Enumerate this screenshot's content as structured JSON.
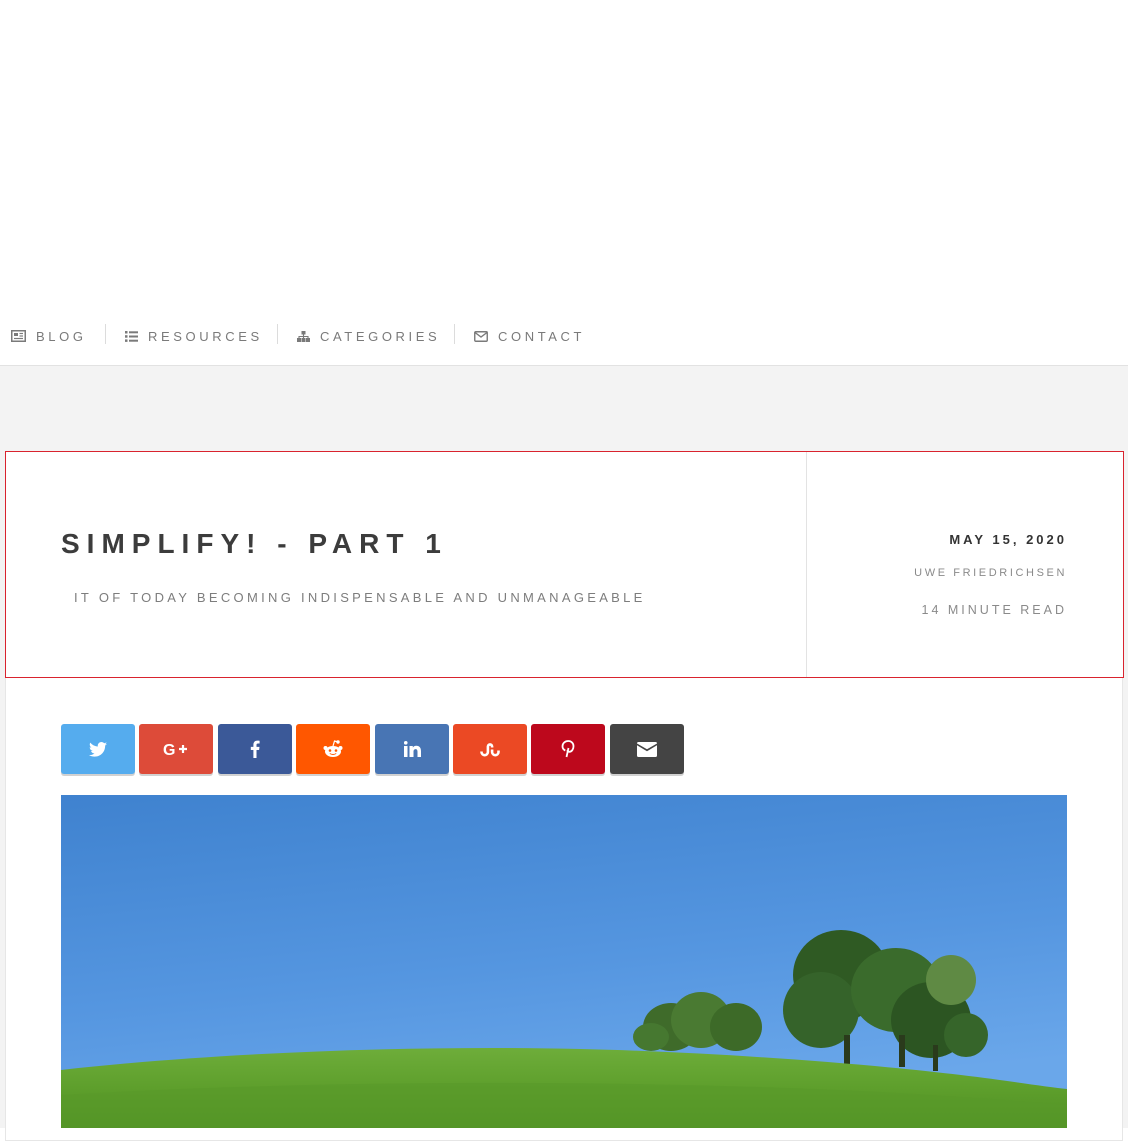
{
  "nav": {
    "items": [
      {
        "label": "BLOG",
        "icon": "newspaper-icon"
      },
      {
        "label": "RESOURCES",
        "icon": "list-icon"
      },
      {
        "label": "CATEGORIES",
        "icon": "sitemap-icon"
      },
      {
        "label": "CONTACT",
        "icon": "envelope-icon"
      }
    ]
  },
  "post": {
    "title": "SIMPLIFY! - PART 1",
    "subtitle": "IT OF TODAY BECOMING INDISPENSABLE AND UNMANAGEABLE",
    "date": "MAY 15, 2020",
    "author": "UWE FRIEDRICHSEN",
    "read_time": "14 MINUTE READ"
  },
  "share": {
    "buttons": [
      {
        "network": "twitter",
        "icon": "twitter-icon",
        "color": "#55acee"
      },
      {
        "network": "google-plus",
        "icon": "google-plus-icon",
        "color": "#dd4b39"
      },
      {
        "network": "facebook",
        "icon": "facebook-icon",
        "color": "#3b5998"
      },
      {
        "network": "reddit",
        "icon": "reddit-icon",
        "color": "#ff5700"
      },
      {
        "network": "linkedin",
        "icon": "linkedin-icon",
        "color": "#4875b4"
      },
      {
        "network": "stumbleupon",
        "icon": "stumbleupon-icon",
        "color": "#eb4924"
      },
      {
        "network": "pinterest",
        "icon": "pinterest-icon",
        "color": "#bd081c"
      },
      {
        "network": "email",
        "icon": "envelope-icon",
        "color": "#444444"
      }
    ]
  },
  "colors": {
    "header_border": "#d9232e",
    "nav_text": "#7a7a7a",
    "page_background": "#f3f3f3"
  }
}
